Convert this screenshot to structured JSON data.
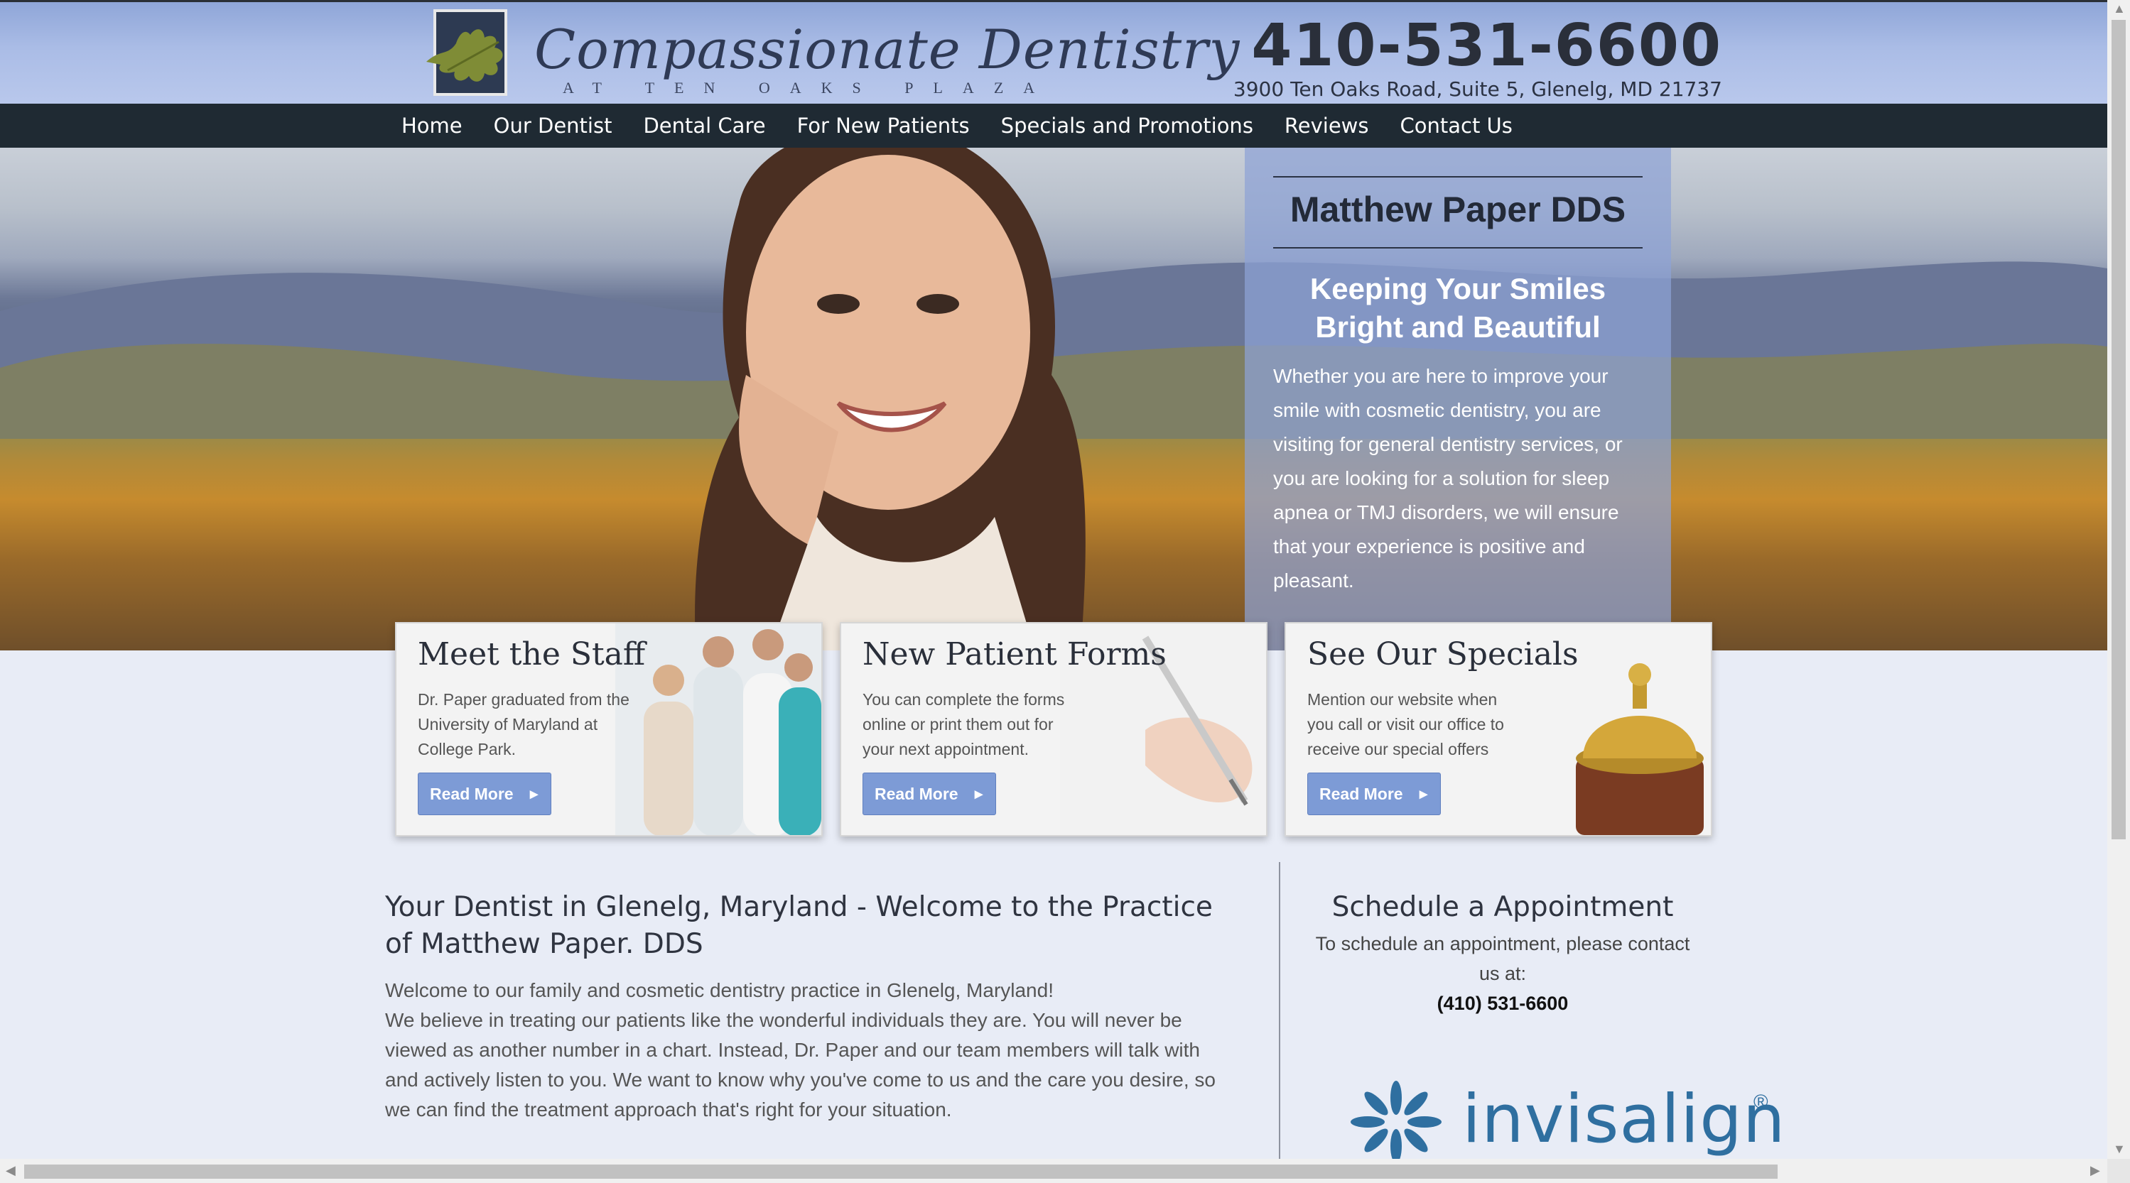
{
  "header": {
    "logo_title": "Compassionate Dentistry",
    "logo_subtitle": "AT TEN OAKS PLAZA",
    "phone": "410-531-6600",
    "address": "3900 Ten Oaks Road, Suite 5, Glenelg, MD 21737"
  },
  "nav": {
    "items": [
      "Home",
      "Our Dentist",
      "Dental Care",
      "For New Patients",
      "Specials and Promotions",
      "Reviews",
      "Contact Us"
    ]
  },
  "hero": {
    "name": "Matthew Paper DDS",
    "tagline": "Keeping Your Smiles Bright and Beautiful",
    "body": "Whether you are here to improve your smile with cosmetic dentistry, you are visiting for general dentistry services, or you are looking for a solution for sleep apnea or TMJ disorders, we will ensure that your experience is positive and pleasant."
  },
  "cards": [
    {
      "title": "Meet the Staff",
      "text": "Dr. Paper graduated from the University of Maryland at College Park.",
      "button": "Read More"
    },
    {
      "title": "New Patient Forms",
      "text": "You can complete the forms online or print them out for your next appointment.",
      "button": "Read More"
    },
    {
      "title": "See Our Specials",
      "text": "Mention our website when you call or visit our office to receive our special offers",
      "button": "Read More"
    }
  ],
  "content": {
    "title": "Your Dentist in Glenelg, Maryland - Welcome to the Practice of Matthew Paper. DDS",
    "para1": "Welcome to our family and cosmetic dentistry practice in Glenelg, Maryland!",
    "para2": "We believe in treating our patients like the wonderful individuals they are. You will never be viewed as another number in a chart. Instead, Dr. Paper and our team members will talk with and actively listen to you. We want to know why you've come to us and the care you desire, so we can find the treatment approach that's right for your situation."
  },
  "schedule": {
    "title": "Schedule a Appointment",
    "text": "To schedule an appointment, please contact us at:",
    "phone": "(410) 531-6600"
  },
  "invisalign": {
    "brand": "invisalign",
    "mark": "®"
  },
  "colors": {
    "header_blue": "#aabce6",
    "nav_dark": "#1f2a33",
    "button_blue": "#7d9bd6",
    "panel_blue": "#8da2d5"
  }
}
